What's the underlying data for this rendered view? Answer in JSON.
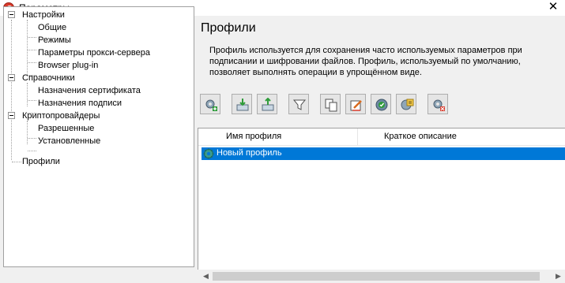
{
  "window": {
    "title": "Параметры",
    "close_glyph": "✕"
  },
  "tree": {
    "items": [
      {
        "label": "Настройки",
        "level": 0
      },
      {
        "label": "Общие",
        "level": 1
      },
      {
        "label": "Режимы",
        "level": 1
      },
      {
        "label": "Параметры прокси-сервера",
        "level": 1
      },
      {
        "label": "Browser plug-in",
        "level": 1
      },
      {
        "label": "Справочники",
        "level": 0
      },
      {
        "label": "Назначения сертификата",
        "level": 1
      },
      {
        "label": "Назначения подписи",
        "level": 1
      },
      {
        "label": "Криптопровайдеры",
        "level": 0
      },
      {
        "label": "Разрешенные",
        "level": 1
      },
      {
        "label": "Установленные",
        "level": 1
      },
      {
        "label": "Профили",
        "level": 0
      }
    ]
  },
  "panel": {
    "title": "Профили",
    "description": "Профиль используется для сохранения часто используемых параметров при подписании и шифровании файлов. Профиль, используемый по умолчанию, позволяет выполнять операции в упрощённом виде."
  },
  "toolbar": {
    "buttons": [
      {
        "icon": "add-profile-icon"
      },
      {
        "icon": "import-icon"
      },
      {
        "icon": "export-icon"
      },
      {
        "icon": "filter-icon"
      },
      {
        "icon": "copy-icon"
      },
      {
        "icon": "edit-icon"
      },
      {
        "icon": "set-default-icon"
      },
      {
        "icon": "properties-icon"
      },
      {
        "icon": "delete-profile-icon"
      }
    ]
  },
  "list": {
    "columns": [
      "Имя профиля",
      "Краткое описание"
    ],
    "rows": [
      {
        "name": "Новый профиль",
        "description": "",
        "selected": true
      }
    ]
  },
  "colors": {
    "selection": "#0078d7",
    "accent_red": "#d83a2b",
    "gear_teal": "#3a9c8c"
  }
}
